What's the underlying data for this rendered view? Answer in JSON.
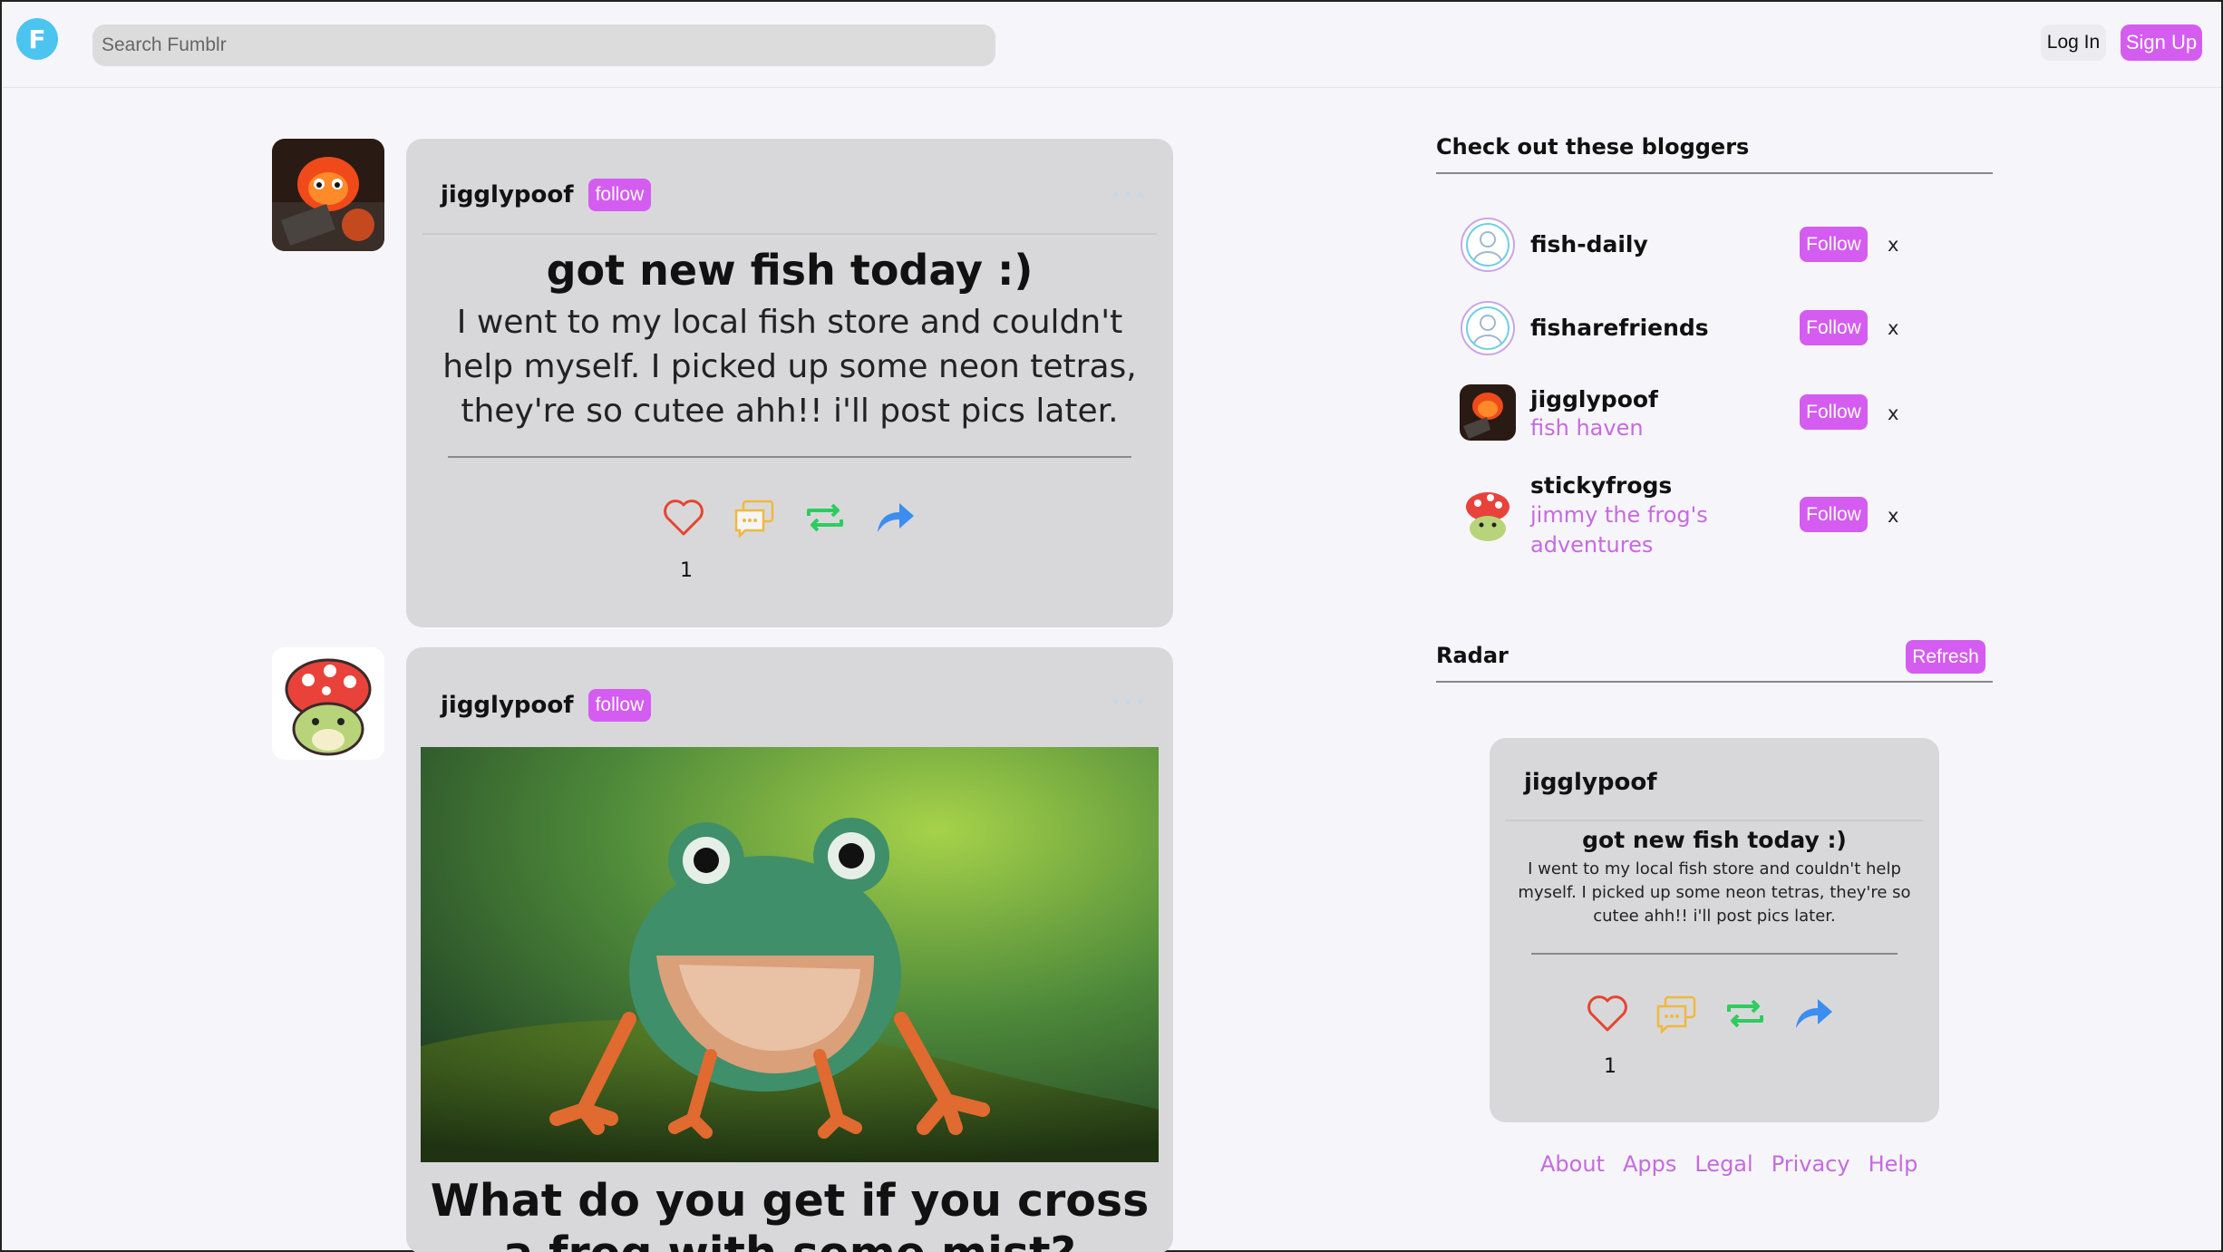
{
  "header": {
    "logo_letter": "F",
    "search_placeholder": "Search Fumblr",
    "login_label": "Log In",
    "signup_label": "Sign Up"
  },
  "posts": [
    {
      "username": "jigglypoof",
      "follow_label": "follow",
      "more": "•••",
      "title": "got new fish today :)",
      "body": "I went to my local fish store and couldn't help myself. I picked up some neon tetras, they're so cutee ahh!! i'll post pics later.",
      "like_count": "1"
    },
    {
      "username": "jigglypoof",
      "follow_label": "follow",
      "more": "•••",
      "title": "What do you get if you cross a frog with some mist?"
    }
  ],
  "sidebar": {
    "bloggers_title": "Check out these bloggers",
    "bloggers": [
      {
        "name": "fish-daily",
        "subtitle": "",
        "follow_label": "Follow",
        "dismiss": "x"
      },
      {
        "name": "fisharefriends",
        "subtitle": "",
        "follow_label": "Follow",
        "dismiss": "x"
      },
      {
        "name": "jigglypoof",
        "subtitle": "fish haven",
        "follow_label": "Follow",
        "dismiss": "x"
      },
      {
        "name": "stickyfrogs",
        "subtitle_line1": "jimmy the frog's",
        "subtitle_line2": "adventures",
        "follow_label": "Follow",
        "dismiss": "x"
      }
    ],
    "radar_title": "Radar",
    "refresh_label": "Refresh",
    "radar_post": {
      "username": "jigglypoof",
      "title": "got new fish today :)",
      "body": "I went to my local fish store and couldn't help myself. I picked up some neon tetras, they're so cutee ahh!! i'll post pics later.",
      "like_count": "1"
    },
    "footer_links": [
      "About",
      "Apps",
      "Legal",
      "Privacy",
      "Help"
    ]
  },
  "colors": {
    "accent": "#d45cf0",
    "card": "#d8d8db",
    "like": "#e5452f",
    "comment": "#f0b93a",
    "reblog": "#2ecc5e",
    "share": "#3b8df0"
  },
  "icons": [
    "heart-icon",
    "comment-icon",
    "reblog-icon",
    "share-icon",
    "user-placeholder-icon"
  ]
}
